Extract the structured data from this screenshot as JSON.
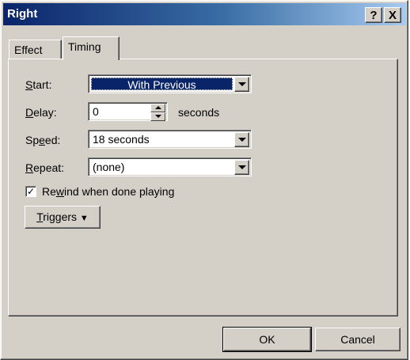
{
  "window": {
    "title": "Right",
    "help_glyph": "?",
    "close_glyph": "X"
  },
  "tabs": [
    {
      "label": "Effect",
      "active": false
    },
    {
      "label": "Timing",
      "active": true
    }
  ],
  "form": {
    "start": {
      "label_u": "S",
      "label_rest": "tart:",
      "value": "With Previous"
    },
    "delay": {
      "label_u": "D",
      "label_rest": "elay:",
      "value": "0",
      "unit": "seconds"
    },
    "speed": {
      "label_pre": "Sp",
      "label_u": "e",
      "label_rest": "ed:",
      "value": "18 seconds"
    },
    "repeat": {
      "label_u": "R",
      "label_rest": "epeat:",
      "value": "(none)"
    },
    "rewind": {
      "label_pre": "Re",
      "label_u": "w",
      "label_rest": "ind when done playing",
      "checked": true,
      "check_glyph": "✓"
    }
  },
  "triggers": {
    "label_u": "T",
    "label_rest": "riggers",
    "glyph": "❖"
  },
  "buttons": {
    "ok": "OK",
    "cancel": "Cancel"
  },
  "colors": {
    "selection": "#0a246a",
    "face": "#d4d0c8",
    "title_start": "#0a246a"
  }
}
